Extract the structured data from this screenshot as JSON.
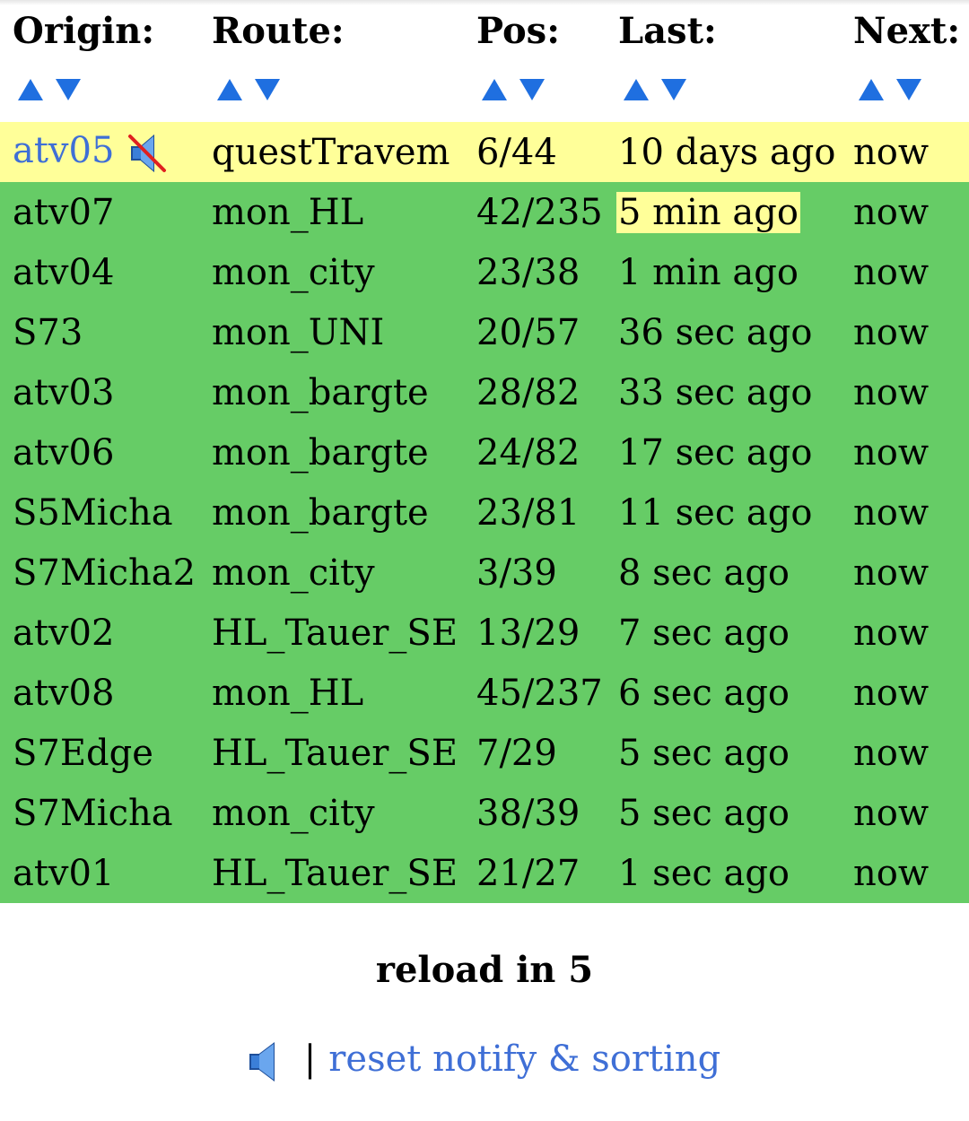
{
  "headers": [
    "Origin:",
    "Route:",
    "Pos:",
    "Last:",
    "Next:"
  ],
  "sort_icons": {
    "up": "sort-ascending-icon",
    "down": "sort-descending-icon",
    "color": "#1f6fe0"
  },
  "colors": {
    "ok": "#66cc66",
    "warn": "#ffff99",
    "link": "#3f6fd6"
  },
  "rows": [
    {
      "origin": "atv05",
      "route": "questTravem",
      "pos": "6/44",
      "last": "10 days ago",
      "next": "now",
      "status": "warn",
      "origin_link": true,
      "muted": true,
      "last_highlight": false
    },
    {
      "origin": "atv07",
      "route": "mon_HL",
      "pos": "42/235",
      "last": "5 min ago",
      "next": "now",
      "status": "ok",
      "origin_link": false,
      "muted": false,
      "last_highlight": true
    },
    {
      "origin": "atv04",
      "route": "mon_city",
      "pos": "23/38",
      "last": "1 min ago",
      "next": "now",
      "status": "ok",
      "origin_link": false,
      "muted": false,
      "last_highlight": false
    },
    {
      "origin": "S73",
      "route": "mon_UNI",
      "pos": "20/57",
      "last": "36 sec ago",
      "next": "now",
      "status": "ok",
      "origin_link": false,
      "muted": false,
      "last_highlight": false
    },
    {
      "origin": "atv03",
      "route": "mon_bargte",
      "pos": "28/82",
      "last": "33 sec ago",
      "next": "now",
      "status": "ok",
      "origin_link": false,
      "muted": false,
      "last_highlight": false
    },
    {
      "origin": "atv06",
      "route": "mon_bargte",
      "pos": "24/82",
      "last": "17 sec ago",
      "next": "now",
      "status": "ok",
      "origin_link": false,
      "muted": false,
      "last_highlight": false
    },
    {
      "origin": "S5Micha",
      "route": "mon_bargte",
      "pos": "23/81",
      "last": "11 sec ago",
      "next": "now",
      "status": "ok",
      "origin_link": false,
      "muted": false,
      "last_highlight": false
    },
    {
      "origin": "S7Micha2",
      "route": "mon_city",
      "pos": "3/39",
      "last": "8 sec ago",
      "next": "now",
      "status": "ok",
      "origin_link": false,
      "muted": false,
      "last_highlight": false
    },
    {
      "origin": "atv02",
      "route": "HL_Tauer_SE",
      "pos": "13/29",
      "last": "7 sec ago",
      "next": "now",
      "status": "ok",
      "origin_link": false,
      "muted": false,
      "last_highlight": false
    },
    {
      "origin": "atv08",
      "route": "mon_HL",
      "pos": "45/237",
      "last": "6 sec ago",
      "next": "now",
      "status": "ok",
      "origin_link": false,
      "muted": false,
      "last_highlight": false
    },
    {
      "origin": "S7Edge",
      "route": "HL_Tauer_SE",
      "pos": "7/29",
      "last": "5 sec ago",
      "next": "now",
      "status": "ok",
      "origin_link": false,
      "muted": false,
      "last_highlight": false
    },
    {
      "origin": "S7Micha",
      "route": "mon_city",
      "pos": "38/39",
      "last": "5 sec ago",
      "next": "now",
      "status": "ok",
      "origin_link": false,
      "muted": false,
      "last_highlight": false
    },
    {
      "origin": "atv01",
      "route": "HL_Tauer_SE",
      "pos": "21/27",
      "last": "1 sec ago",
      "next": "now",
      "status": "ok",
      "origin_link": false,
      "muted": false,
      "last_highlight": false
    }
  ],
  "reload": {
    "label": "reload in 5"
  },
  "footer": {
    "sound_icon": "speaker-icon",
    "separator": "|",
    "reset_label": "reset notify & sorting"
  }
}
